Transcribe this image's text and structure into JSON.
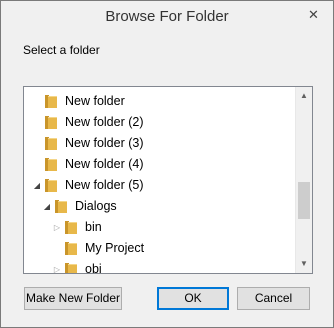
{
  "dialog": {
    "title": "Browse For Folder",
    "close_glyph": "✕",
    "prompt": "Select a folder"
  },
  "tree": {
    "items": [
      {
        "label": "New folder",
        "depth": 0,
        "expander": "none"
      },
      {
        "label": "New folder (2)",
        "depth": 0,
        "expander": "none"
      },
      {
        "label": "New folder (3)",
        "depth": 0,
        "expander": "none"
      },
      {
        "label": "New folder (4)",
        "depth": 0,
        "expander": "none"
      },
      {
        "label": "New folder (5)",
        "depth": 0,
        "expander": "expanded"
      },
      {
        "label": "Dialogs",
        "depth": 1,
        "expander": "expanded"
      },
      {
        "label": "bin",
        "depth": 2,
        "expander": "collapsed"
      },
      {
        "label": "My Project",
        "depth": 2,
        "expander": "none"
      },
      {
        "label": "obj",
        "depth": 2,
        "expander": "collapsed"
      }
    ],
    "scroll_up_glyph": "▲",
    "scroll_down_glyph": "▼"
  },
  "buttons": {
    "make_new_folder": "Make New Folder",
    "ok": "OK",
    "cancel": "Cancel"
  },
  "colors": {
    "folder_fill": "#e8b84a",
    "folder_dark": "#c9952a"
  }
}
